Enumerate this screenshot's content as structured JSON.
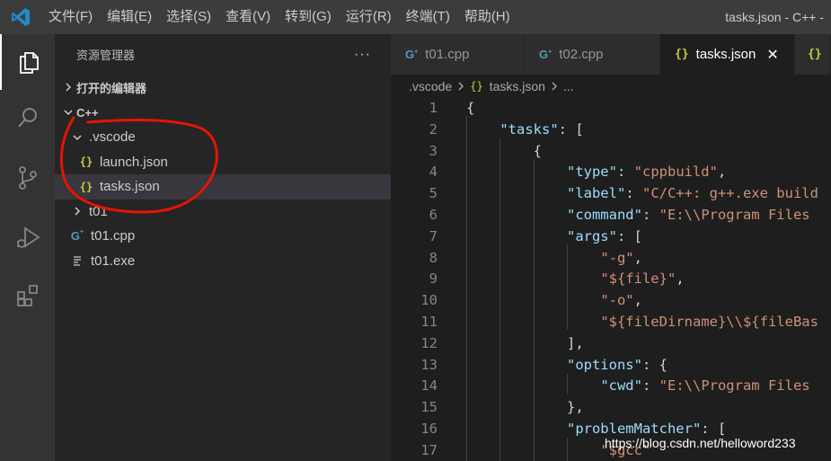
{
  "menu": [
    "文件(F)",
    "编辑(E)",
    "选择(S)",
    "查看(V)",
    "转到(G)",
    "运行(R)",
    "终端(T)",
    "帮助(H)"
  ],
  "window_title": "tasks.json - C++ -",
  "sidebar": {
    "title": "资源管理器",
    "more": "···",
    "open_editors": "打开的编辑器",
    "folder": "C++",
    "tree": {
      "vscode": ".vscode",
      "launch": "launch.json",
      "tasks": "tasks.json",
      "t01_folder": "t01",
      "t01_cpp": "t01.cpp",
      "t01_exe": "t01.exe"
    }
  },
  "tabs": {
    "tab1": "t01.cpp",
    "tab2": "t02.cpp",
    "tab3": "tasks.json",
    "close": "✕"
  },
  "breadcrumb": {
    "folder": ".vscode",
    "file": "tasks.json",
    "ellipsis": "..."
  },
  "code_lines": [
    {
      "n": "1",
      "t": "{"
    },
    {
      "n": "2",
      "t": "    \"tasks\": ["
    },
    {
      "n": "3",
      "t": "        {"
    },
    {
      "n": "4",
      "t": "            \"type\": \"cppbuild\","
    },
    {
      "n": "5",
      "t": "            \"label\": \"C/C++: g++.exe build"
    },
    {
      "n": "6",
      "t": "            \"command\": \"E:\\\\Program Files"
    },
    {
      "n": "7",
      "t": "            \"args\": ["
    },
    {
      "n": "8",
      "t": "                \"-g\","
    },
    {
      "n": "9",
      "t": "                \"${file}\","
    },
    {
      "n": "10",
      "t": "                \"-o\","
    },
    {
      "n": "11",
      "t": "                \"${fileDirname}\\\\${fileBas"
    },
    {
      "n": "12",
      "t": "            ],"
    },
    {
      "n": "13",
      "t": "            \"options\": {"
    },
    {
      "n": "14",
      "t": "                \"cwd\": \"E:\\\\Program Files"
    },
    {
      "n": "15",
      "t": "            },"
    },
    {
      "n": "16",
      "t": "            \"problemMatcher\": ["
    },
    {
      "n": "17",
      "t": "                \"$gcc\""
    }
  ],
  "watermark": "https://blog.csdn.net/helloword233",
  "colors": {
    "json_icon": "#cbcb41",
    "cpp_icon": "#519aba",
    "json_key": "#9cdcfe",
    "json_string": "#ce9178",
    "annotation": "#e51400"
  }
}
